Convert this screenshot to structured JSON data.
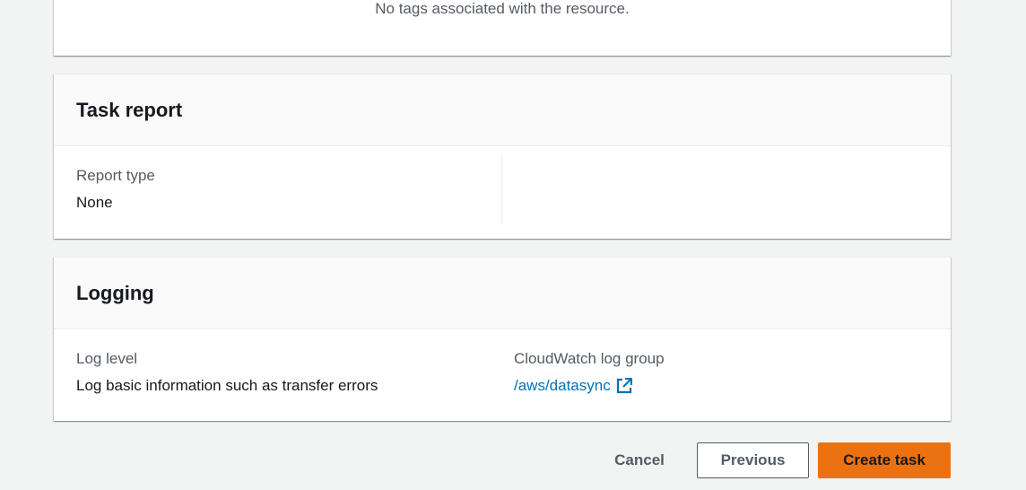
{
  "tags_panel": {
    "empty_text": "No tags associated with the resource."
  },
  "task_report": {
    "title": "Task report",
    "report_type_label": "Report type",
    "report_type_value": "None"
  },
  "logging": {
    "title": "Logging",
    "log_level_label": "Log level",
    "log_level_value": "Log basic information such as transfer errors",
    "log_group_label": "CloudWatch log group",
    "log_group_value": "/aws/datasync"
  },
  "actions": {
    "cancel_label": "Cancel",
    "previous_label": "Previous",
    "create_label": "Create task"
  },
  "colors": {
    "link": "#0073bb",
    "primary_button": "#ec7211",
    "page_background": "#f2f3f3"
  },
  "icons": {
    "external_link": "external-link-icon"
  }
}
